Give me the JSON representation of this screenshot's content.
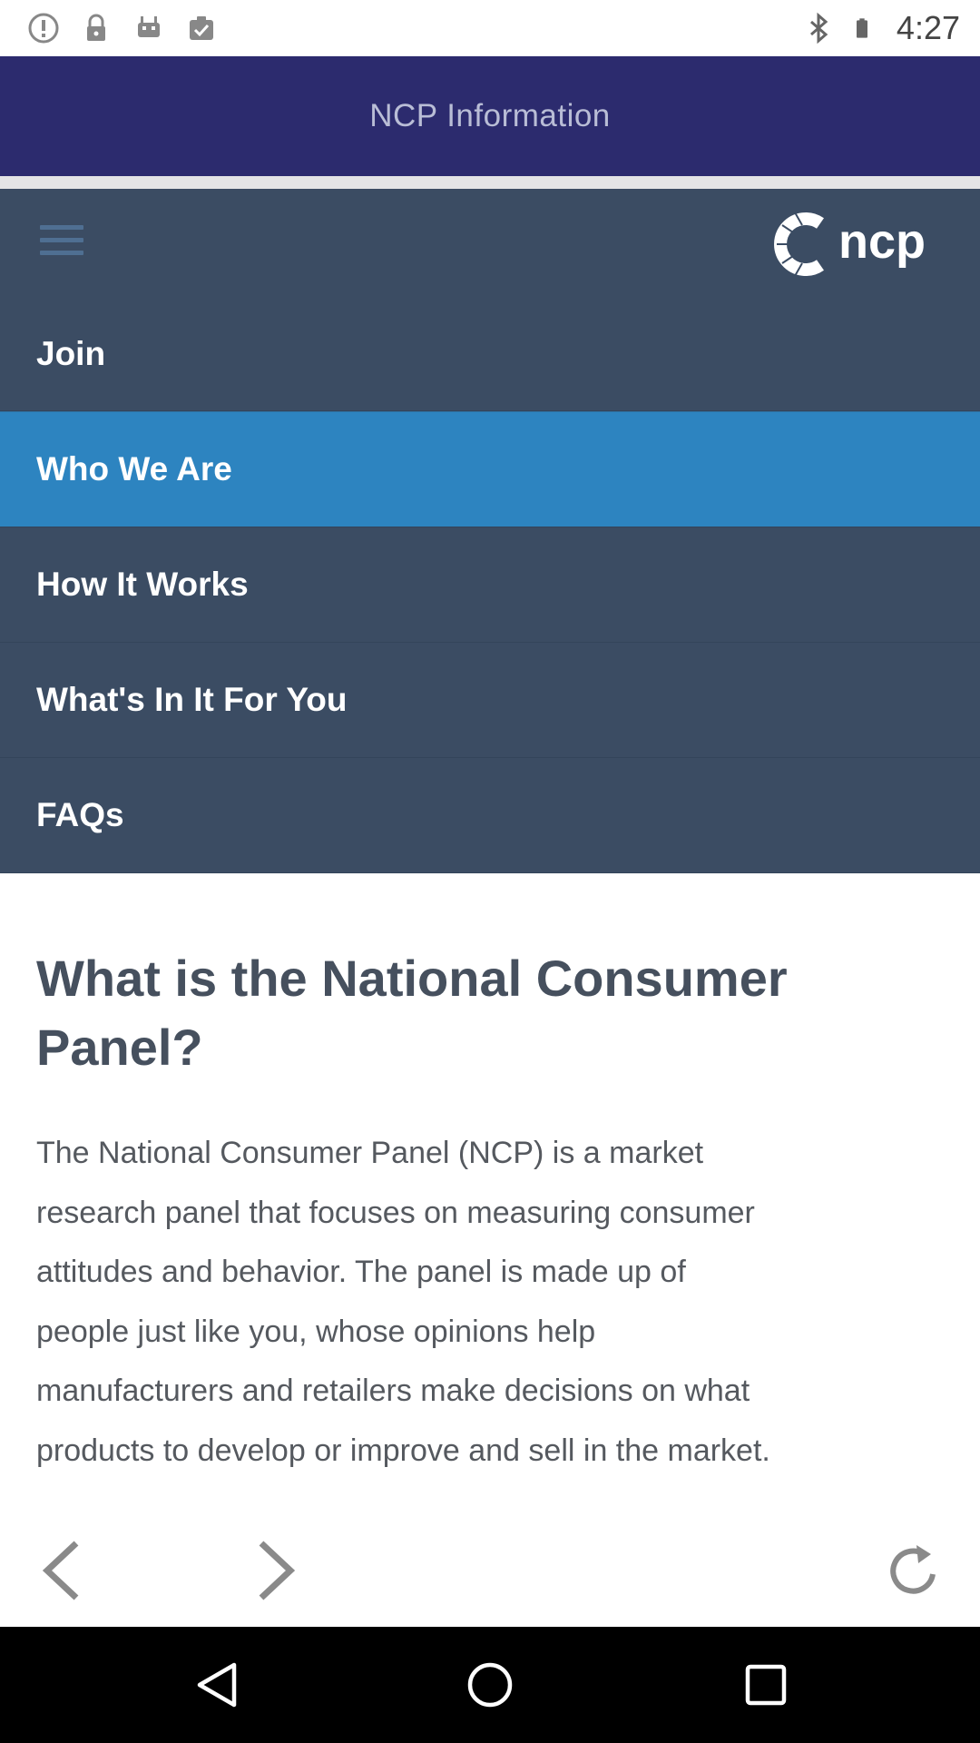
{
  "status_bar": {
    "time": "4:27",
    "left_icons": [
      "alert-circle-icon",
      "lock-icon",
      "android-icon",
      "clipboard-check-icon"
    ],
    "right_icons": [
      "bluetooth-icon",
      "battery-icon"
    ]
  },
  "header": {
    "title": "NCP Information"
  },
  "nav": {
    "menu_icon": "hamburger-icon",
    "logo_text": "ncp",
    "items": [
      {
        "label": "Join",
        "active": false
      },
      {
        "label": "Who We Are",
        "active": true
      },
      {
        "label": "How It Works",
        "active": false
      },
      {
        "label": "What's In It For You",
        "active": false
      },
      {
        "label": "FAQs",
        "active": false
      }
    ]
  },
  "content": {
    "title_lines": [
      "What is the National Consumer",
      "Panel?"
    ],
    "body_lines": [
      "The National Consumer Panel (NCP) is a market",
      "research panel that focuses on measuring consumer",
      "attitudes and behavior. The panel is made up of",
      "people just like you, whose opinions help",
      "manufacturers and retailers make decisions on what",
      "products to develop or improve and sell in the market."
    ]
  },
  "browser_controls": [
    "back-arrow-icon",
    "forward-arrow-icon",
    "refresh-icon"
  ],
  "system_nav": [
    "back-triangle-icon",
    "home-circle-icon",
    "recents-square-icon"
  ],
  "colors": {
    "header_bg": "#2c2b6e",
    "nav_bg": "#3b4c63",
    "active_bg": "#2d84c0",
    "title_text": "#46505e"
  }
}
